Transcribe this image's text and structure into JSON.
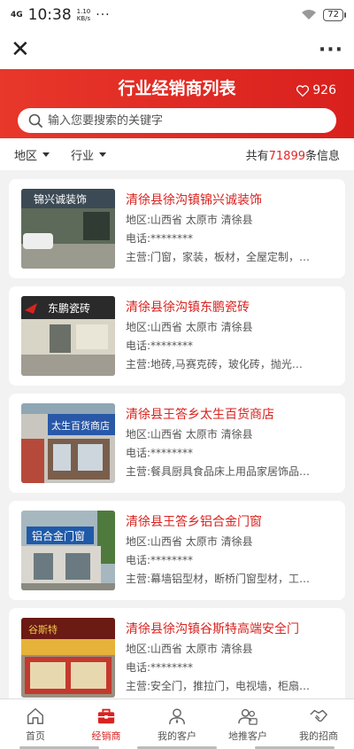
{
  "status_bar": {
    "network": "4G",
    "time": "10:38",
    "speed": "1.10\nKB/s",
    "dots": "···",
    "battery": "72"
  },
  "nav": {
    "close_icon": "close-icon",
    "more_label": "···"
  },
  "header": {
    "title": "行业经销商列表",
    "likes": "926",
    "search_placeholder": "输入您要搜索的关键字",
    "accent": "#e0282a"
  },
  "filters": {
    "region": "地区",
    "industry": "行业",
    "total_prefix": "共有",
    "total_count": "71899",
    "total_suffix": "条信息"
  },
  "dealers": [
    {
      "name": "清徐县徐沟镇锦兴诚装饰",
      "region": "地区:山西省 太原市 清徐县",
      "phone": "电话:********",
      "business": "主营:门窗，家装，板材，全屋定制，…",
      "sign": "锦兴诚装饰"
    },
    {
      "name": "清徐县徐沟镇东鹏瓷砖",
      "region": "地区:山西省 太原市 清徐县",
      "phone": "电话:********",
      "business": "主营:地砖,马赛克砖，玻化砖，抛光…",
      "sign": "东鹏瓷砖"
    },
    {
      "name": "清徐县王答乡太生百货商店",
      "region": "地区:山西省 太原市 清徐县",
      "phone": "电话:********",
      "business": "主营:餐具厨具食品床上用品家居饰品…",
      "sign": "太生百货商店"
    },
    {
      "name": "清徐县王答乡铝合金门窗",
      "region": "地区:山西省 太原市 清徐县",
      "phone": "电话:********",
      "business": "主营:幕墙铝型材，断桥门窗型材，工…",
      "sign": "铝合金门窗"
    },
    {
      "name": "清徐县徐沟镇谷斯特高端安全门",
      "region": "地区:山西省 太原市 清徐县",
      "phone": "电话:********",
      "business": "主营:安全门，推拉门，电视墙，柜扇…",
      "sign": "谷斯特"
    }
  ],
  "tabs": [
    {
      "label": "首页",
      "icon": "home-icon"
    },
    {
      "label": "经销商",
      "icon": "briefcase-icon"
    },
    {
      "label": "我的客户",
      "icon": "user-icon"
    },
    {
      "label": "地推客户",
      "icon": "users-icon"
    },
    {
      "label": "我的招商",
      "icon": "handshake-icon"
    }
  ]
}
